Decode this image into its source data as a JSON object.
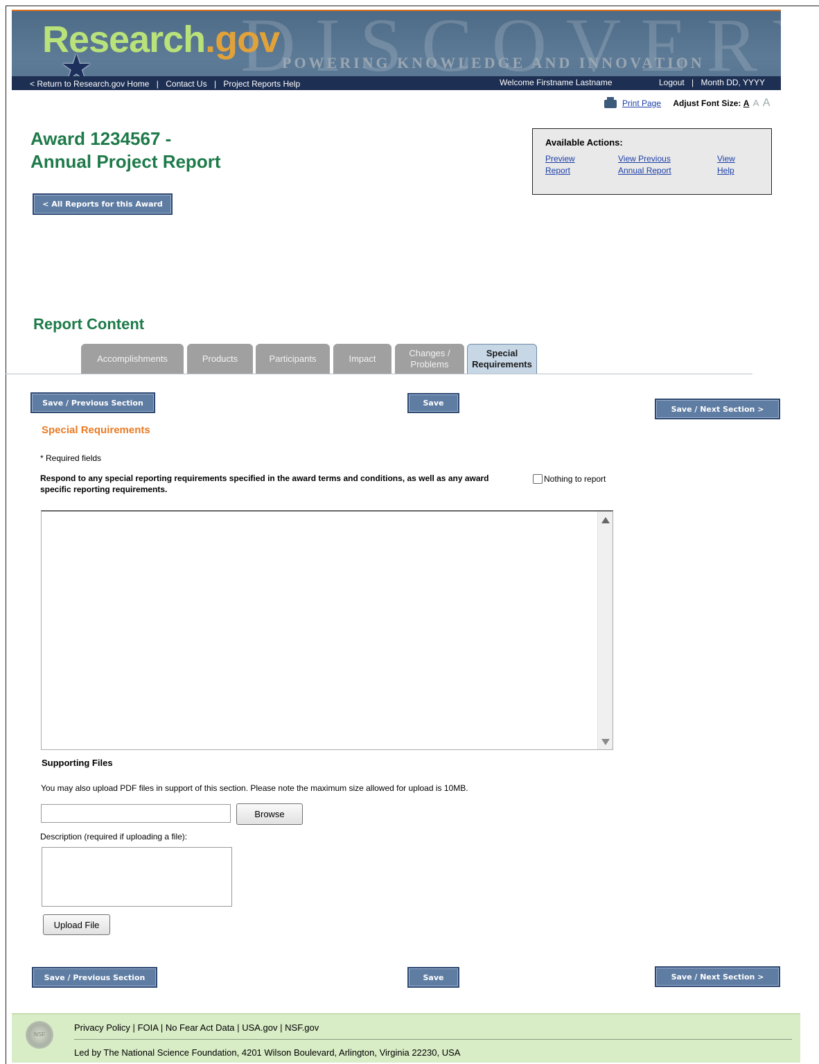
{
  "header": {
    "logo_main": "Research",
    "logo_gov": ".gov",
    "background_word": "DISCOVERY",
    "tagline": "POWERING KNOWLEDGE AND INNOVATION",
    "nav": {
      "return_home": "< Return to Research.gov Home",
      "contact_us": "Contact Us",
      "help": "Project Reports Help",
      "sep": "|",
      "welcome": "Welcome Firstname Lastname",
      "logout": "Logout",
      "date": "Month DD, YYYY"
    }
  },
  "tools": {
    "print": "Print Page",
    "adjust_label": "Adjust Font Size:",
    "size_small": "A",
    "size_medium": "A",
    "size_large": "A"
  },
  "page": {
    "title_line1": "Award 1234567 -",
    "title_line2": "Annual Project Report",
    "all_reports_button": "< All Reports for this Award"
  },
  "available_actions": {
    "heading": "Available Actions:",
    "preview_1": "Preview",
    "preview_2": "Report",
    "view_prev_1": "View Previous",
    "view_prev_2": "Annual Report",
    "view_help_1": "View",
    "view_help_2": "Help"
  },
  "report": {
    "section_title": "Report Content",
    "tabs": [
      {
        "label": "Accomplishments"
      },
      {
        "label": "Products"
      },
      {
        "label": "Participants"
      },
      {
        "label": "Impact"
      },
      {
        "label_1": "Changes /",
        "label_2": "Problems"
      },
      {
        "label_1": "Special",
        "label_2": "Requirements"
      }
    ],
    "buttons": {
      "save_previous": "Save / Previous Section",
      "save": "Save",
      "save_next": "Save / Next Section >"
    },
    "subsection_title": "Special Requirements",
    "required_note": "* Required fields",
    "prompt": "Respond to any special reporting requirements specified in the award terms and conditions, as well as any award specific reporting requirements.",
    "nothing_to_report": "Nothing to report",
    "response_value": ""
  },
  "supporting_files": {
    "title": "Supporting Files",
    "description": "You may also upload PDF files in support of this section. Please note the maximum size allowed for upload is 10MB.",
    "file_value": "",
    "browse": "Browse",
    "description_label": "Description (required if uploading a file):",
    "description_value": "",
    "upload": "Upload File"
  },
  "footer": {
    "seal_text": "NSF",
    "privacy": "Privacy Policy",
    "foia": "FOIA",
    "no_fear": "No Fear Act Data",
    "usa": "USA.gov",
    "nsf": "NSF.gov",
    "sep": "|",
    "address": "Led by The National Science Foundation, 4201 Wilson Boulevard, Arlington, Virginia 22230, USA"
  },
  "colors": {
    "accent_green": "#1e7a4a",
    "accent_orange": "#ea7b24",
    "button_blue": "#5f7da3",
    "nav_dark": "#1d2f52",
    "footer_green": "#d8ecc6"
  }
}
